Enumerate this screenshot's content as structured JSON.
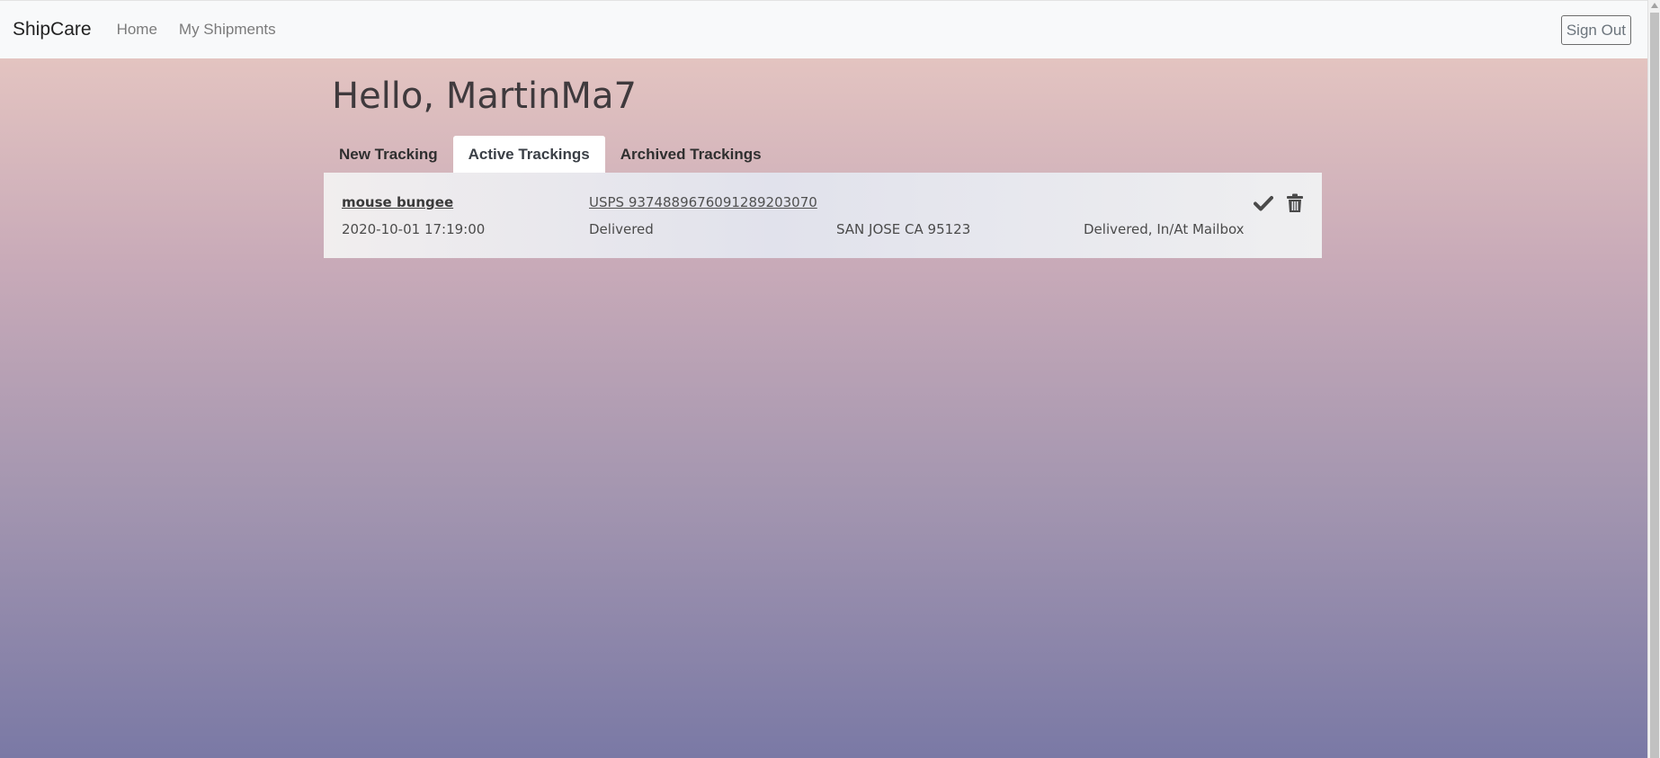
{
  "nav": {
    "brand": "ShipCare",
    "links": [
      "Home",
      "My Shipments"
    ],
    "sign_out": "Sign Out"
  },
  "greeting": "Hello, MartinMa7",
  "tabs": [
    {
      "label": "New Tracking",
      "active": false
    },
    {
      "label": "Active Trackings",
      "active": true
    },
    {
      "label": "Archived Trackings",
      "active": false
    }
  ],
  "shipments": [
    {
      "name": "mouse bungee",
      "tracking": "USPS 9374889676091289203070",
      "date": "2020-10-01 17:19:00",
      "status": "Delivered",
      "location": "SAN JOSE CA 95123",
      "detail": "Delivered, In/At Mailbox",
      "actions": [
        "check-icon",
        "trash-icon"
      ]
    }
  ]
}
